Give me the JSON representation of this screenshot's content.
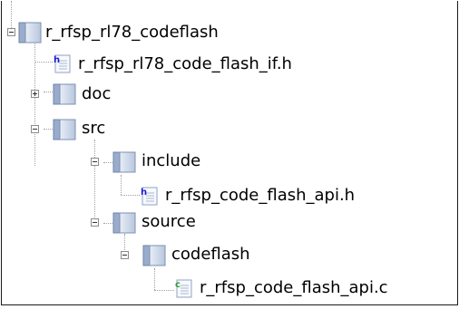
{
  "tree": {
    "root": {
      "label": "r_rfsp_rl78_codeflash",
      "expanded": true,
      "icon": "folder-icon"
    },
    "root_header": {
      "label": "r_rfsp_rl78_code_flash_if.h",
      "icon": "header-file-icon"
    },
    "doc": {
      "label": "doc",
      "expanded": false,
      "icon": "folder-icon"
    },
    "src": {
      "label": "src",
      "expanded": true,
      "icon": "folder-icon"
    },
    "include": {
      "label": "include",
      "expanded": true,
      "icon": "folder-icon"
    },
    "include_header": {
      "label": "r_rfsp_code_flash_api.h",
      "icon": "header-file-icon"
    },
    "source": {
      "label": "source",
      "expanded": true,
      "icon": "folder-icon"
    },
    "codeflash": {
      "label": "codeflash",
      "expanded": true,
      "icon": "folder-icon"
    },
    "source_file": {
      "label": "r_rfsp_code_flash_api.c",
      "icon": "c-source-file-icon"
    }
  },
  "colors": {
    "folder_face": "#c3cfe3",
    "folder_spine": "#8ea3c4",
    "header_marker": "#1b1bd1",
    "source_marker": "#2f9a2f"
  }
}
